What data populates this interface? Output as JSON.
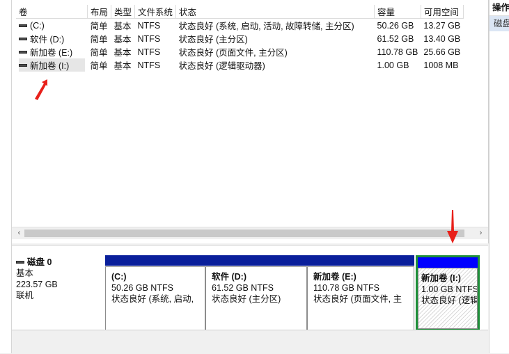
{
  "columns": [
    "卷",
    "布局",
    "类型",
    "文件系统",
    "状态",
    "容量",
    "可用空间"
  ],
  "volumes": [
    {
      "name": "(C:)",
      "layout": "简单",
      "type": "基本",
      "fs": "NTFS",
      "status": "状态良好 (系统, 启动, 活动, 故障转储, 主分区)",
      "capacity": "50.26 GB",
      "free": "13.27 GB"
    },
    {
      "name": "软件 (D:)",
      "layout": "简单",
      "type": "基本",
      "fs": "NTFS",
      "status": "状态良好 (主分区)",
      "capacity": "61.52 GB",
      "free": "13.40 GB"
    },
    {
      "name": "新加卷 (E:)",
      "layout": "简单",
      "type": "基本",
      "fs": "NTFS",
      "status": "状态良好 (页面文件, 主分区)",
      "capacity": "110.78 GB",
      "free": "25.66 GB"
    },
    {
      "name": "新加卷 (I:)",
      "layout": "简单",
      "type": "基本",
      "fs": "NTFS",
      "status": "状态良好 (逻辑驱动器)",
      "capacity": "1.00 GB",
      "free": "1008 MB"
    }
  ],
  "scroll": {
    "left": "‹",
    "right": "›"
  },
  "disk": {
    "name": "磁盘 0",
    "type": "基本",
    "size": "223.57 GB",
    "state": "联机"
  },
  "partitions": [
    {
      "name": "(C:)",
      "size_fs": "50.26 GB NTFS",
      "status": "状态良好 (系统, 启动,"
    },
    {
      "name": "软件  (D:)",
      "size_fs": "61.52 GB NTFS",
      "status": "状态良好 (主分区)"
    },
    {
      "name": "新加卷  (E:)",
      "size_fs": "110.78 GB NTFS",
      "status": "状态良好 (页面文件, 主"
    },
    {
      "name": "新加卷  (I:)",
      "size_fs": "1.00 GB NTFS",
      "status": "状态良好 (逻辑驱动器)"
    }
  ],
  "actions": {
    "header": "操作",
    "item": "磁盘"
  },
  "colors": {
    "partition_bar": "#0a1f9b",
    "selected_bar": "#0000ff",
    "selected_border": "#1f8f3a",
    "annotation_arrow": "#e8201a"
  }
}
